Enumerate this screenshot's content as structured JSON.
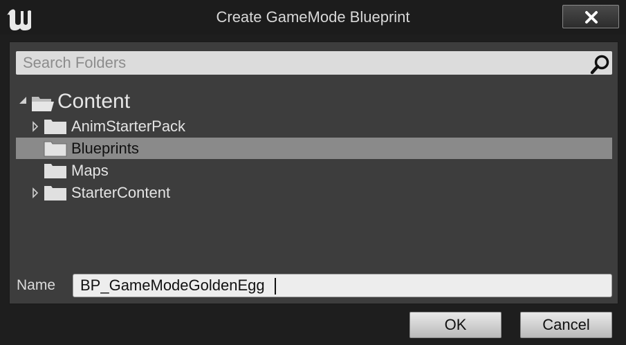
{
  "dialog": {
    "title": "Create GameMode Blueprint",
    "close_icon": "close-icon",
    "logo_icon": "unreal-engine-logo"
  },
  "search": {
    "placeholder": "Search Folders",
    "value": "",
    "icon": "search-icon"
  },
  "tree": {
    "root": {
      "label": "Content",
      "expanded": true,
      "icon": "folder-open-icon"
    },
    "items": [
      {
        "label": "AnimStarterPack",
        "has_children": true,
        "selected": false,
        "icon": "folder-icon"
      },
      {
        "label": "Blueprints",
        "has_children": false,
        "selected": true,
        "icon": "folder-icon"
      },
      {
        "label": "Maps",
        "has_children": false,
        "selected": false,
        "icon": "folder-icon"
      },
      {
        "label": "StarterContent",
        "has_children": true,
        "selected": false,
        "icon": "folder-icon"
      }
    ]
  },
  "name_field": {
    "label": "Name",
    "value": "BP_GameModeGoldenEgg"
  },
  "buttons": {
    "ok": "OK",
    "cancel": "Cancel"
  },
  "colors": {
    "background": "#1e1e1e",
    "panel": "#3d3d3d",
    "selection": "#8a8a8a",
    "text": "#e4e4e4"
  }
}
